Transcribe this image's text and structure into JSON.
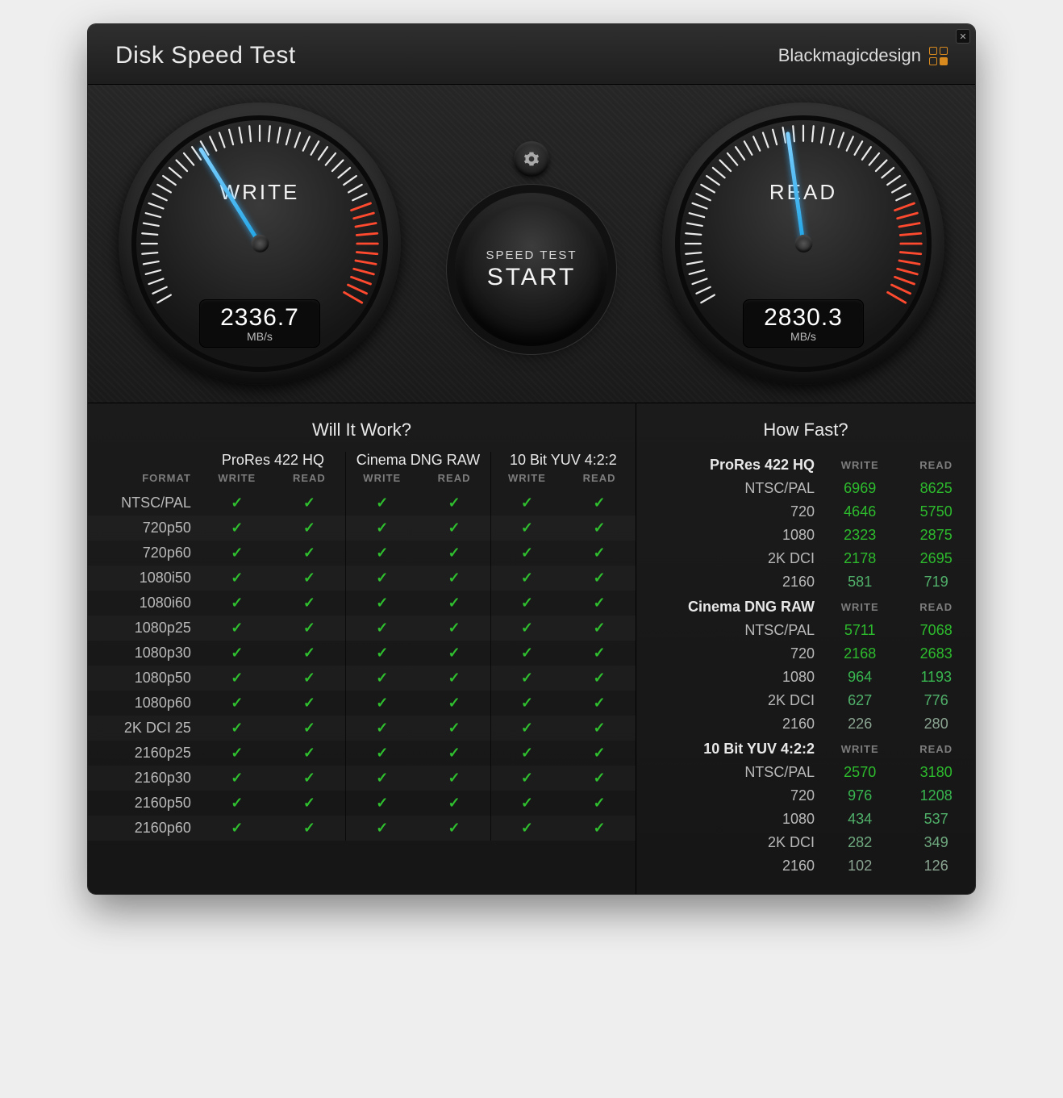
{
  "app_title": "Disk Speed Test",
  "brand": "Blackmagicdesign",
  "gauges": {
    "write": {
      "label": "WRITE",
      "value": "2336.7",
      "unit": "MB/s",
      "angle": -32
    },
    "read": {
      "label": "READ",
      "value": "2830.3",
      "unit": "MB/s",
      "angle": -8
    }
  },
  "start_button": {
    "line1": "SPEED TEST",
    "line2": "START"
  },
  "gear_icon_name": "gear-icon",
  "left_panel": {
    "title": "Will It Work?",
    "format_header": "FORMAT",
    "sub_headers": [
      "WRITE",
      "READ"
    ],
    "codecs": [
      "ProRes 422 HQ",
      "Cinema DNG RAW",
      "10 Bit YUV 4:2:2"
    ],
    "formats": [
      "NTSC/PAL",
      "720p50",
      "720p60",
      "1080i50",
      "1080i60",
      "1080p25",
      "1080p30",
      "1080p50",
      "1080p60",
      "2K DCI 25",
      "2160p25",
      "2160p30",
      "2160p50",
      "2160p60"
    ]
  },
  "right_panel": {
    "title": "How Fast?",
    "sub_headers": [
      "WRITE",
      "READ"
    ],
    "groups": [
      {
        "codec": "ProRes 422 HQ",
        "rows": [
          {
            "fmt": "NTSC/PAL",
            "write": 6969,
            "read": 8625,
            "shade": "g1"
          },
          {
            "fmt": "720",
            "write": 4646,
            "read": 5750,
            "shade": "g1"
          },
          {
            "fmt": "1080",
            "write": 2323,
            "read": 2875,
            "shade": "g1"
          },
          {
            "fmt": "2K DCI",
            "write": 2178,
            "read": 2695,
            "shade": "g1"
          },
          {
            "fmt": "2160",
            "write": 581,
            "read": 719,
            "shade": "g3"
          }
        ]
      },
      {
        "codec": "Cinema DNG RAW",
        "rows": [
          {
            "fmt": "NTSC/PAL",
            "write": 5711,
            "read": 7068,
            "shade": "g1"
          },
          {
            "fmt": "720",
            "write": 2168,
            "read": 2683,
            "shade": "g1"
          },
          {
            "fmt": "1080",
            "write": 964,
            "read": 1193,
            "shade": "g2"
          },
          {
            "fmt": "2K DCI",
            "write": 627,
            "read": 776,
            "shade": "g3"
          },
          {
            "fmt": "2160",
            "write": 226,
            "read": 280,
            "shade": "g5"
          }
        ]
      },
      {
        "codec": "10 Bit YUV 4:2:2",
        "rows": [
          {
            "fmt": "NTSC/PAL",
            "write": 2570,
            "read": 3180,
            "shade": "g1"
          },
          {
            "fmt": "720",
            "write": 976,
            "read": 1208,
            "shade": "g2"
          },
          {
            "fmt": "1080",
            "write": 434,
            "read": 537,
            "shade": "g3"
          },
          {
            "fmt": "2K DCI",
            "write": 282,
            "read": 349,
            "shade": "g4"
          },
          {
            "fmt": "2160",
            "write": 102,
            "read": 126,
            "shade": "g5"
          }
        ]
      }
    ]
  },
  "chart_data": {
    "type": "table",
    "title": "Disk Speed Test",
    "gauges": {
      "write_MBps": 2336.7,
      "read_MBps": 2830.3
    },
    "will_it_work": {
      "codecs": [
        "ProRes 422 HQ",
        "Cinema DNG RAW",
        "10 Bit YUV 4:2:2"
      ],
      "formats": [
        "NTSC/PAL",
        "720p50",
        "720p60",
        "1080i50",
        "1080i60",
        "1080p25",
        "1080p30",
        "1080p50",
        "1080p60",
        "2K DCI 25",
        "2160p25",
        "2160p30",
        "2160p50",
        "2160p60"
      ],
      "all_pass": true
    },
    "how_fast_frames_per_stream": {
      "ProRes 422 HQ": {
        "NTSC/PAL": {
          "write": 6969,
          "read": 8625
        },
        "720": {
          "write": 4646,
          "read": 5750
        },
        "1080": {
          "write": 2323,
          "read": 2875
        },
        "2K DCI": {
          "write": 2178,
          "read": 2695
        },
        "2160": {
          "write": 581,
          "read": 719
        }
      },
      "Cinema DNG RAW": {
        "NTSC/PAL": {
          "write": 5711,
          "read": 7068
        },
        "720": {
          "write": 2168,
          "read": 2683
        },
        "1080": {
          "write": 964,
          "read": 1193
        },
        "2K DCI": {
          "write": 627,
          "read": 776
        },
        "2160": {
          "write": 226,
          "read": 280
        }
      },
      "10 Bit YUV 4:2:2": {
        "NTSC/PAL": {
          "write": 2570,
          "read": 3180
        },
        "720": {
          "write": 976,
          "read": 1208
        },
        "1080": {
          "write": 434,
          "read": 537
        },
        "2K DCI": {
          "write": 282,
          "read": 349
        },
        "2160": {
          "write": 102,
          "read": 126
        }
      }
    }
  }
}
